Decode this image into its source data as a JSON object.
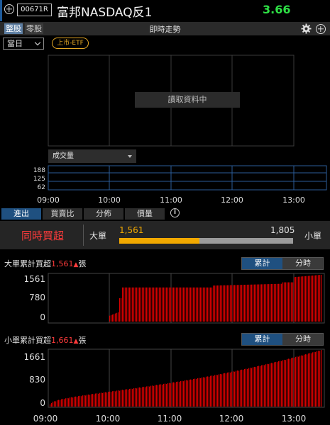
{
  "header": {
    "code": "00671R",
    "name": "富邦NASDAQ反1",
    "price": "3.66",
    "price_color": "#2ee045"
  },
  "toolbar": {
    "seg_whole": "整股",
    "seg_odd": "零股",
    "title": "即時走勢",
    "settings_icon": "gear-icon",
    "add_icon": "plus-circle-icon"
  },
  "controls": {
    "period": "當日",
    "market_badge": "上市-ETF"
  },
  "main_chart": {
    "loading_text": "讀取資料中"
  },
  "volume": {
    "selector": "成交量",
    "y_ticks": [
      "188",
      "125",
      "62"
    ],
    "x_ticks": [
      "09:00",
      "10:00",
      "11:00",
      "12:00",
      "13:00"
    ]
  },
  "tabs": [
    "進出",
    "買賣比",
    "分佈",
    "價量"
  ],
  "flow": {
    "label": "同時買超",
    "large": "大單",
    "small": "小單",
    "large_value": "1,561",
    "small_value": "1,805",
    "large_ratio": 0.46,
    "large_color": "#f2a900",
    "small_color": "#9b9b9b"
  },
  "large_section": {
    "title_prefix": "大單累計買超",
    "value": "1,561",
    "unit": "張",
    "btn_cum": "累計",
    "btn_min": "分時",
    "y_ticks": [
      "1561",
      "780",
      "0"
    ]
  },
  "small_section": {
    "title_prefix": "小單累計買超",
    "value": "1,661",
    "unit": "張",
    "btn_cum": "累計",
    "btn_min": "分時",
    "y_ticks": [
      "1661",
      "830",
      "0"
    ],
    "x_ticks": [
      "09:00",
      "10:00",
      "11:00",
      "12:00",
      "13:00"
    ]
  }
}
